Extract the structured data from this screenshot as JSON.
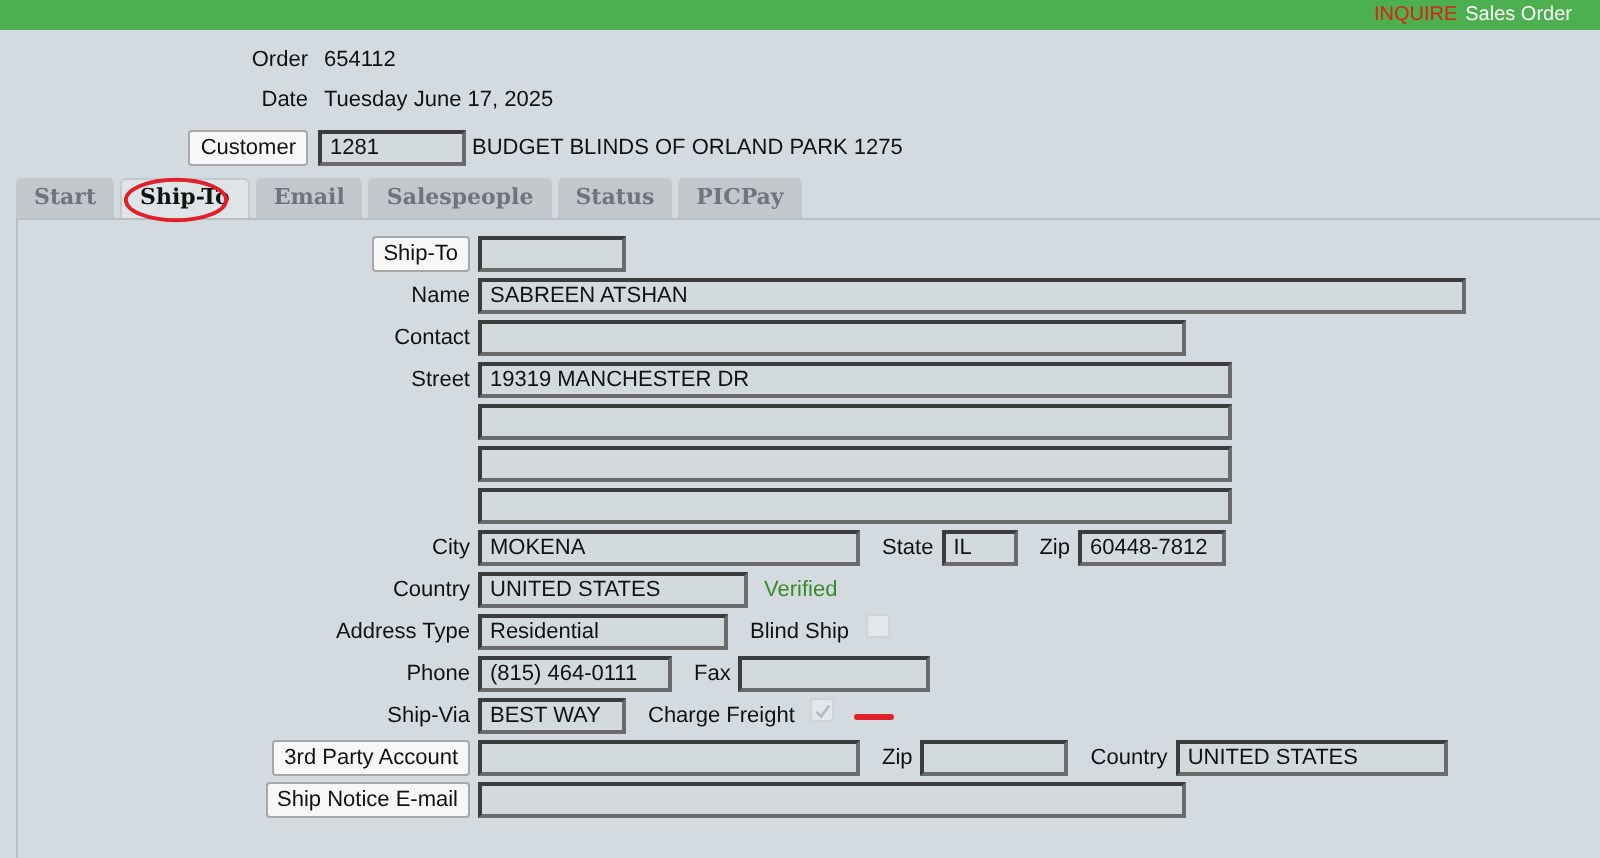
{
  "header": {
    "mode": "INQUIRE",
    "title": "Sales Order"
  },
  "order": {
    "label": "Order",
    "value": "654112"
  },
  "date": {
    "label": "Date",
    "value": "Tuesday June 17, 2025"
  },
  "customer": {
    "button": "Customer",
    "number": "1281",
    "name": "BUDGET BLINDS OF ORLAND PARK 1275"
  },
  "tabs": [
    {
      "label": "Start",
      "selected": false,
      "circled": false
    },
    {
      "label": "Ship-To",
      "selected": true,
      "circled": true
    },
    {
      "label": "Email",
      "selected": false,
      "circled": false
    },
    {
      "label": "Salespeople",
      "selected": false,
      "circled": false
    },
    {
      "label": "Status",
      "selected": false,
      "circled": false
    },
    {
      "label": "PICPay",
      "selected": false,
      "circled": false
    }
  ],
  "rows": [
    {
      "lead": {
        "kind": "button",
        "text": "Ship-To"
      },
      "items": [
        {
          "kind": "field"
        }
      ]
    },
    {
      "lead": {
        "kind": "label",
        "text": "Name"
      },
      "items": [
        {
          "kind": "field",
          "value": "SABREEN ATSHAN"
        }
      ]
    },
    {
      "lead": {
        "kind": "label",
        "text": "Contact"
      },
      "items": [
        {
          "kind": "field"
        }
      ]
    },
    {
      "lead": {
        "kind": "label",
        "text": "Street"
      },
      "items": [
        {
          "kind": "field",
          "value": "19319 MANCHESTER DR"
        }
      ]
    },
    {
      "items": [
        {
          "kind": "field"
        }
      ]
    },
    {
      "items": [
        {
          "kind": "field"
        }
      ]
    },
    {
      "items": [
        {
          "kind": "field"
        }
      ]
    },
    {
      "lead": {
        "kind": "label",
        "text": "City"
      },
      "items": [
        {
          "kind": "field",
          "value": "MOKENA"
        },
        {
          "kind": "label",
          "text": "State"
        },
        {
          "kind": "field",
          "value": "IL"
        },
        {
          "kind": "label",
          "text": "Zip"
        },
        {
          "kind": "field",
          "value": "60448-7812"
        }
      ]
    },
    {
      "lead": {
        "kind": "label",
        "text": "Country"
      },
      "items": [
        {
          "kind": "field",
          "value": "UNITED STATES"
        },
        {
          "kind": "status",
          "text": "Verified"
        }
      ]
    },
    {
      "lead": {
        "kind": "label",
        "text": "Address Type"
      },
      "items": [
        {
          "kind": "field",
          "value": "Residential"
        },
        {
          "kind": "label",
          "text": "Blind Ship"
        },
        {
          "kind": "checkbox",
          "checked": false
        }
      ]
    },
    {
      "lead": {
        "kind": "label",
        "text": "Phone"
      },
      "items": [
        {
          "kind": "field",
          "value": "(815) 464-0111"
        },
        {
          "kind": "label",
          "text": "Fax"
        },
        {
          "kind": "field"
        }
      ]
    },
    {
      "lead": {
        "kind": "label",
        "text": "Ship-Via"
      },
      "items": [
        {
          "kind": "field",
          "value": "BEST WAY"
        },
        {
          "kind": "label",
          "text": "Charge Freight"
        },
        {
          "kind": "checkbox",
          "checked": true
        },
        {
          "kind": "mark"
        }
      ]
    },
    {
      "lead": {
        "kind": "button",
        "text": "3rd Party Account"
      },
      "items": [
        {
          "kind": "field"
        },
        {
          "kind": "label",
          "text": "Zip"
        },
        {
          "kind": "field"
        },
        {
          "kind": "label",
          "text": "Country"
        },
        {
          "kind": "field",
          "value": "UNITED STATES"
        }
      ]
    },
    {
      "lead": {
        "kind": "button",
        "text": "Ship Notice E-mail"
      },
      "items": [
        {
          "kind": "field"
        }
      ]
    }
  ]
}
